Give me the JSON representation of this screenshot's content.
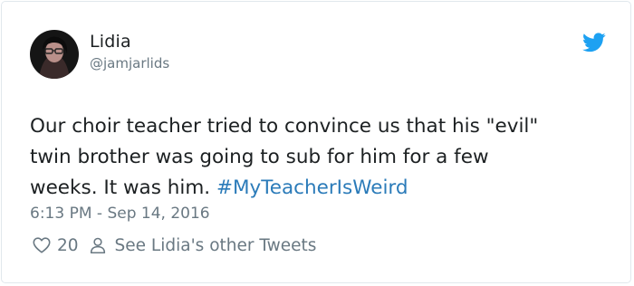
{
  "tweet": {
    "author": {
      "name": "Lidia",
      "handle": "@jamjarlids"
    },
    "text_main": "Our choir teacher tried to convince us that his \"evil\"\ntwin brother was going to sub for him for a few\nweeks. It was him. ",
    "hashtag": "#MyTeacherIsWeird",
    "timestamp": "6:13 PM - Sep 14, 2016",
    "likes": "20",
    "other_tweets_label": "See Lidia's other Tweets"
  },
  "colors": {
    "twitter_blue": "#1da1f2",
    "hashtag_blue": "#2b7bb9",
    "meta_gray": "#697882",
    "text": "#1c2022"
  },
  "icons": {
    "brand": "twitter-bird-icon",
    "like": "heart-icon",
    "profile": "person-icon"
  }
}
